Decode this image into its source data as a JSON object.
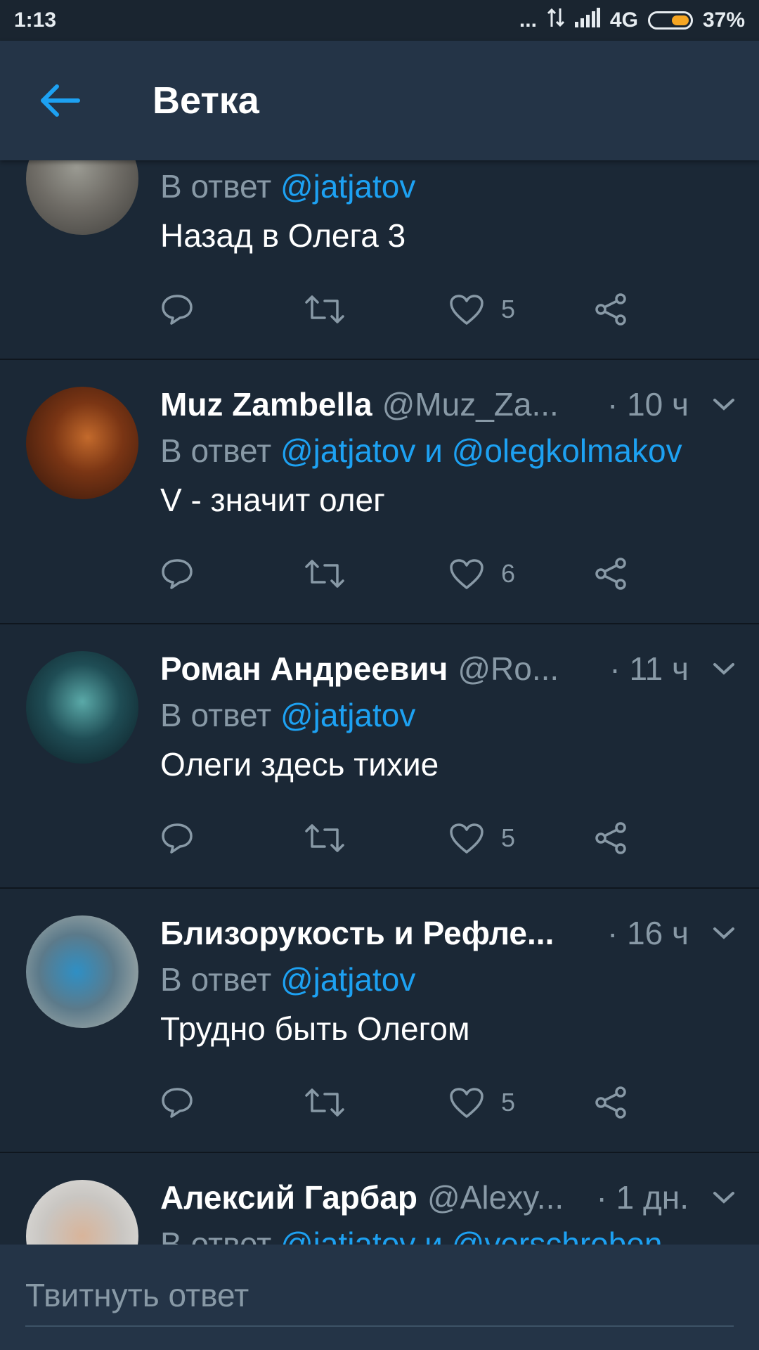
{
  "status": {
    "time": "1:13",
    "dots": "...",
    "network": "4G",
    "battery": "37%"
  },
  "header": {
    "title": "Ветка"
  },
  "tweets": [
    {
      "name": "",
      "handle": "",
      "time": "",
      "reply_prefix": "В ответ",
      "reply_links": "@jatjatov",
      "text": "Назад в Олега 3",
      "likes": "5"
    },
    {
      "name": "Muz Zambella",
      "handle": "@Muz_Za...",
      "time": "· 10 ч",
      "reply_prefix": "В ответ",
      "reply_links": "@jatjatov и @olegkolmakov",
      "text": "V - значит олег",
      "likes": "6"
    },
    {
      "name": "Роман Андреевич",
      "handle": "@Ro...",
      "time": "· 11 ч",
      "reply_prefix": "В ответ",
      "reply_links": "@jatjatov",
      "text": "Олеги здесь тихие",
      "likes": "5"
    },
    {
      "name": "Близорукость и Рефле...",
      "handle": "",
      "time": "· 16 ч",
      "reply_prefix": "В ответ",
      "reply_links": "@jatjatov",
      "text": "Трудно быть Олегом",
      "likes": "5"
    },
    {
      "name": "Алексий Гарбар",
      "handle": "@Alexy...",
      "time": "· 1 дн.",
      "reply_prefix": "В ответ",
      "reply_links": "@jatjatov и @verschroben_",
      "text": "",
      "likes": ""
    }
  ],
  "composer": {
    "placeholder": "Твитнуть ответ"
  },
  "colors": {
    "accent": "#1da1f2",
    "background": "#1b2836",
    "header": "#243447",
    "muted": "#8899a6"
  }
}
